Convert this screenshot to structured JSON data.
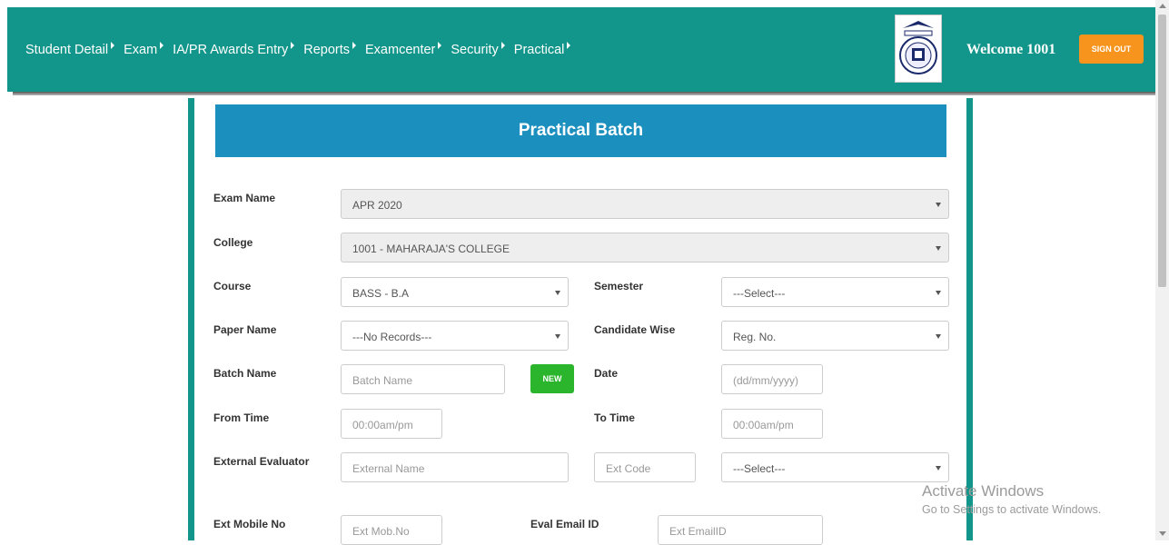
{
  "nav": {
    "items": [
      {
        "label": "Student Detail"
      },
      {
        "label": "Exam"
      },
      {
        "label": "IA/PR Awards Entry"
      },
      {
        "label": "Reports"
      },
      {
        "label": "Examcenter"
      },
      {
        "label": "Security"
      },
      {
        "label": "Practical"
      }
    ]
  },
  "header": {
    "welcome": "Welcome 1001",
    "signout": "SIGN OUT"
  },
  "form": {
    "title": "Practical Batch",
    "exam_name": {
      "label": "Exam Name",
      "value": "APR 2020"
    },
    "college": {
      "label": "College",
      "value": "1001 - MAHARAJA'S COLLEGE"
    },
    "course": {
      "label": "Course",
      "value": "BASS - B.A"
    },
    "semester": {
      "label": "Semester",
      "value": "---Select---"
    },
    "paper_name": {
      "label": "Paper Name",
      "value": "---No Records---"
    },
    "candidate_wise": {
      "label": "Candidate Wise",
      "value": "Reg. No."
    },
    "batch_name": {
      "label": "Batch Name",
      "placeholder": "Batch Name"
    },
    "new_button": "NEW",
    "date": {
      "label": "Date",
      "placeholder": "(dd/mm/yyyy)"
    },
    "from_time": {
      "label": "From Time",
      "placeholder": "00:00am/pm"
    },
    "to_time": {
      "label": "To Time",
      "placeholder": "00:00am/pm"
    },
    "external_evaluator": {
      "label": "External Evaluator",
      "name_placeholder": "External Name",
      "code_placeholder": "Ext Code",
      "select_value": "---Select---"
    },
    "ext_mobile": {
      "label": "Ext Mobile No",
      "placeholder": "Ext Mob.No"
    },
    "eval_email": {
      "label": "Eval Email ID",
      "placeholder": "Ext EmailID"
    }
  },
  "watermark": {
    "line1": "Activate Windows",
    "line2": "Go to Settings to activate Windows."
  },
  "colors": {
    "topbar": "#12958a",
    "header_blue": "#1b8fbe",
    "signout_orange": "#f7941d",
    "new_green": "#2bb52d"
  }
}
